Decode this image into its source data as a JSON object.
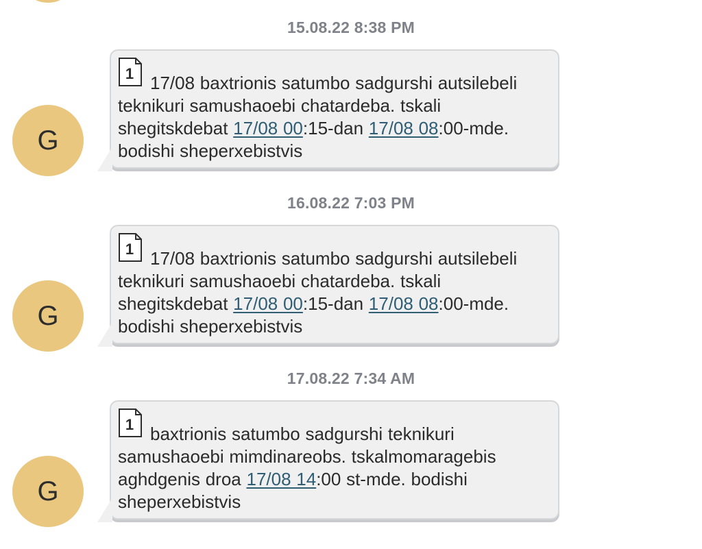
{
  "messages": [
    {
      "timestamp": "15.08.22 8:38 PM",
      "avatar_letter": "G",
      "sim_slot": "1",
      "parts": [
        {
          "text": "17/08 baxtrionis satumbo sadgurshi autsilebeli teknikuri samushaoebi chatardeba. tskali shegitskdebat "
        },
        {
          "link": "17/08 00"
        },
        {
          "text": ":15-dan "
        },
        {
          "link": "17/08 08"
        },
        {
          "text": ":00-mde. bodishi sheperxebistvis"
        }
      ]
    },
    {
      "timestamp": "16.08.22 7:03 PM",
      "avatar_letter": "G",
      "sim_slot": "1",
      "parts": [
        {
          "text": "17/08 baxtrionis satumbo sadgurshi autsilebeli teknikuri samushaoebi chatardeba. tskali shegitskdebat "
        },
        {
          "link": "17/08 00"
        },
        {
          "text": ":15-dan "
        },
        {
          "link": "17/08 08"
        },
        {
          "text": ":00-mde. bodishi sheperxebistvis"
        }
      ]
    },
    {
      "timestamp": "17.08.22 7:34 AM",
      "avatar_letter": "G",
      "sim_slot": "1",
      "parts": [
        {
          "text": "baxtrionis satumbo sadgurshi teknikuri samushaoebi mimdinareobs. tskalmomaragebis aghdgenis droa "
        },
        {
          "link": "17/08 14"
        },
        {
          "text": ":00 st-mde. bodishi sheperxebistvis"
        }
      ]
    }
  ],
  "colors": {
    "avatar_bg": "#e9c77e",
    "bubble_bg": "#f0f0f1",
    "timestamp": "#7f8288",
    "link": "#2f5d73"
  },
  "icons": {
    "sim": "sim-card-icon"
  }
}
